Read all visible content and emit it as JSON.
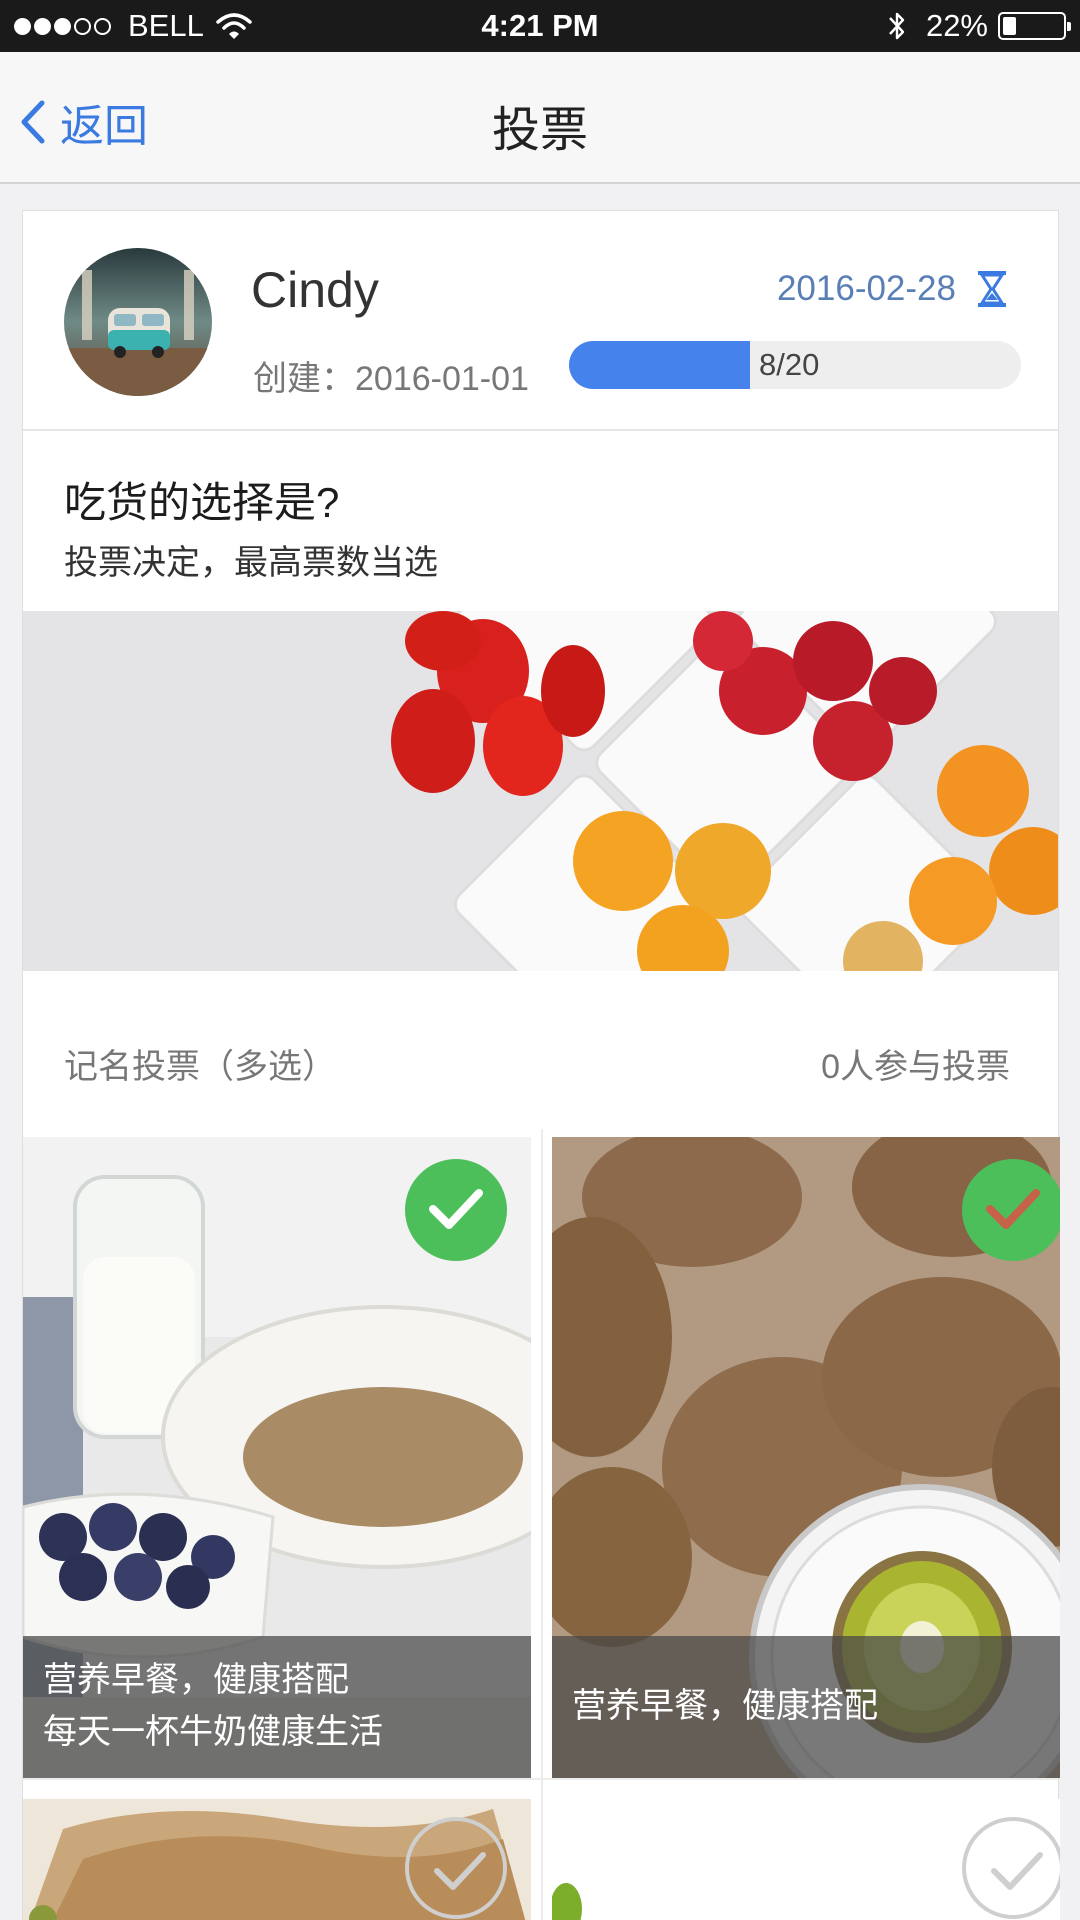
{
  "status_bar": {
    "carrier": "BELL",
    "signal": [
      true,
      true,
      true,
      false,
      false
    ],
    "time": "4:21 PM",
    "battery_percent": "22%",
    "battery_level": 0.22
  },
  "nav": {
    "back_label": "返回",
    "title": "投票"
  },
  "poll": {
    "author": "Cindy",
    "created": "创建：2016-01-01",
    "deadline": "2016-02-28",
    "progress": {
      "text": "8/20",
      "value": 8,
      "max": 20
    },
    "question": "吃货的选择是?",
    "subtext": "投票决定，最高票数当选",
    "vote_mode": "记名投票（多选）",
    "participants": "0人参与投票",
    "options": [
      {
        "caption_line1": "营养早餐，健康搭配",
        "caption_line2": "每天一杯牛奶健康生活",
        "checked": true
      },
      {
        "caption_line1": "营养早餐，健康搭配",
        "checked": true
      },
      {
        "checked": false
      },
      {
        "checked": false
      }
    ]
  },
  "colors": {
    "accent": "#3b7ae0",
    "progress_fill": "#4682ec",
    "check_green": "#4cbf5b",
    "deadline_text": "#5a7fb5"
  },
  "icons": {
    "back": "chevron-left-icon",
    "deadline": "hourglass-icon",
    "check": "checkmark-icon"
  }
}
